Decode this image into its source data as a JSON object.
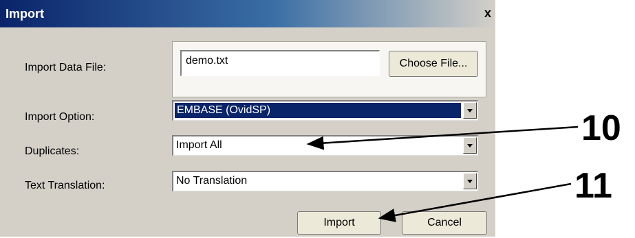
{
  "dialog": {
    "title": "Import",
    "close_glyph": "x"
  },
  "form": {
    "import_data_file_label": "Import Data File:",
    "import_data_file_value": "demo.txt",
    "choose_file_label": "Choose File...",
    "import_option_label": "Import Option:",
    "import_option_value": "EMBASE (OvidSP)",
    "duplicates_label": "Duplicates:",
    "duplicates_value": "Import All",
    "text_translation_label": "Text Translation:",
    "text_translation_value": "No Translation"
  },
  "buttons": {
    "import_label": "Import",
    "cancel_label": "Cancel"
  },
  "callouts": {
    "duplicates_number": "10",
    "import_number": "11"
  },
  "icons": {
    "dropdown": "chevron-down-icon",
    "close": "close-icon"
  },
  "colors": {
    "title_bar": "#0a246a",
    "selection": "#0a246a",
    "dialog_bg": "#d4d0c8"
  }
}
